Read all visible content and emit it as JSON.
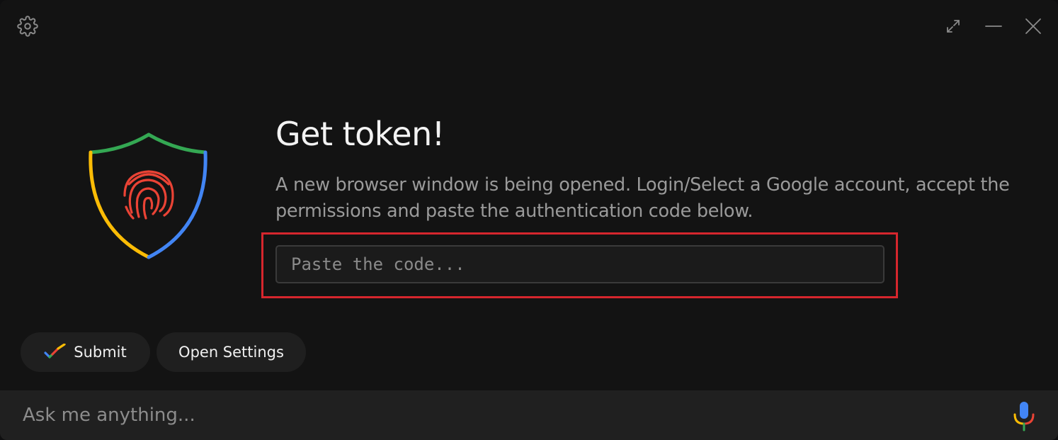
{
  "window": {
    "settings_icon": "gear-icon",
    "expand_icon": "expand-icon",
    "minimize_icon": "minimize-icon",
    "close_icon": "close-icon"
  },
  "main": {
    "title": "Get token!",
    "description": "A new browser window is being opened. Login/Select a Google account, accept the permissions and paste the authentication code below.",
    "code_input": {
      "value": "",
      "placeholder": "Paste the code..."
    },
    "illustration_icon": "shield-fingerprint-icon"
  },
  "actions": {
    "submit_label": "Submit",
    "submit_icon": "checkmark-icon",
    "open_settings_label": "Open Settings"
  },
  "footer": {
    "ask_input": {
      "value": "",
      "placeholder": "Ask me anything..."
    },
    "mic_icon": "microphone-icon"
  },
  "colors": {
    "background": "#131313",
    "highlight": "#d6262d",
    "google_blue": "#4285f4",
    "google_red": "#ea4335",
    "google_yellow": "#fbbc05",
    "google_green": "#34a853"
  }
}
